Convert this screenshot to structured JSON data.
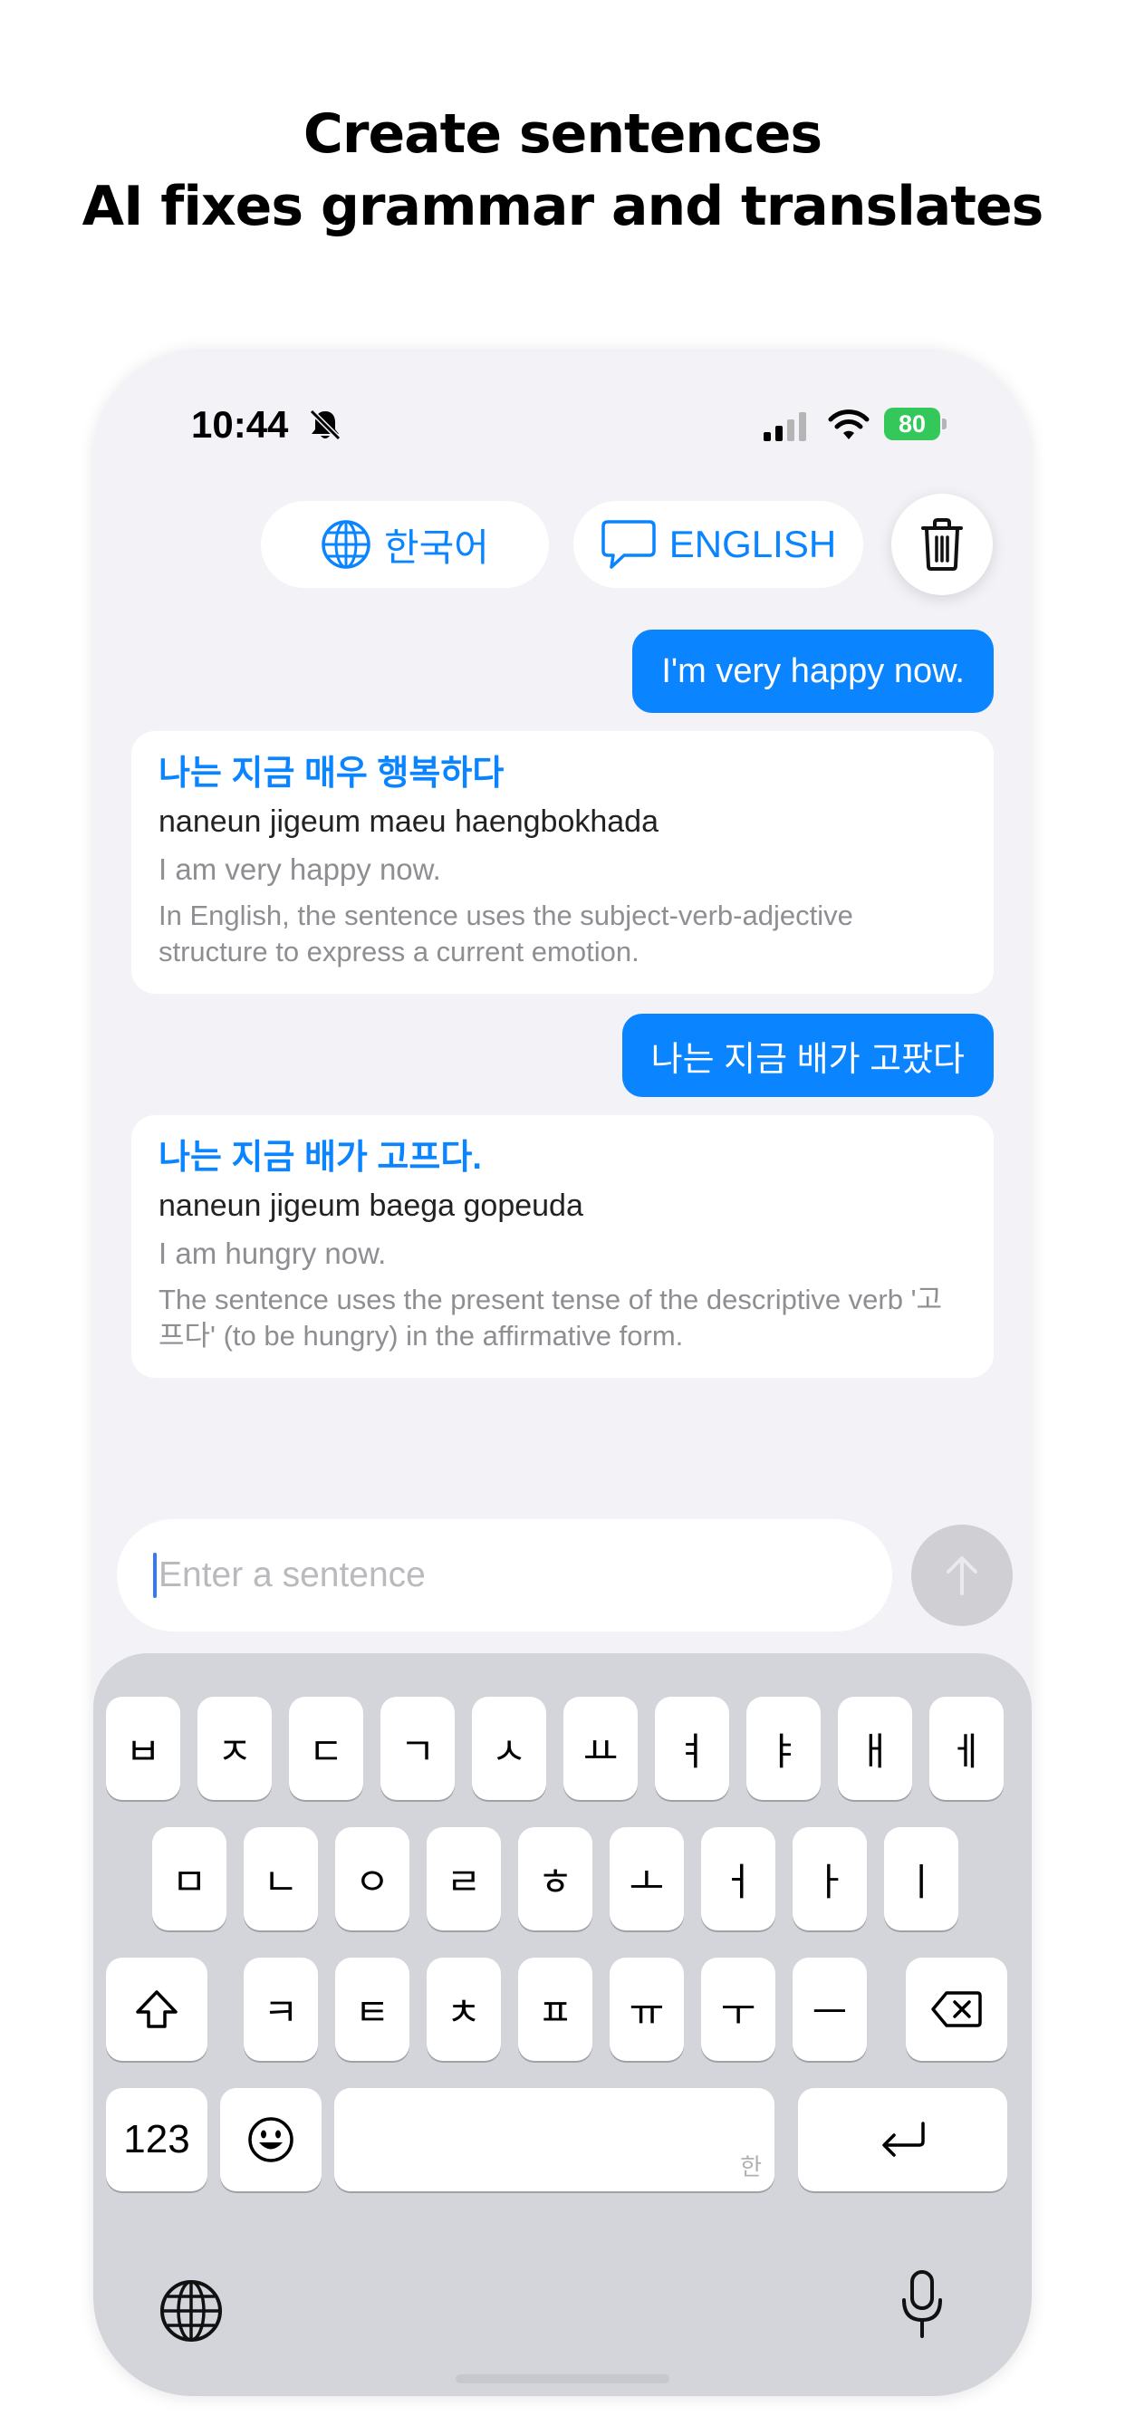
{
  "promo": {
    "line1": "Create sentences",
    "line2": "AI fixes grammar and translates"
  },
  "status_bar": {
    "time": "10:44",
    "battery": "80"
  },
  "toolbar": {
    "source_language": "한국어",
    "target_language": "ENGLISH",
    "globe_icon": "globe-icon",
    "chat_icon": "chat-bubble-icon",
    "trash_icon": "trash-icon"
  },
  "conversation": [
    {
      "user_message": "I'm very happy now.",
      "result": {
        "korean": "나는 지금 매우 행복하다",
        "romanization": "naneun jigeum maeu haengbokhada",
        "translation": "I am very happy now.",
        "explanation": "In English, the sentence uses the subject-verb-adjective structure to express a current emotion."
      }
    },
    {
      "user_message": "나는 지금 배가 고팠다",
      "result": {
        "korean": "나는 지금 배가 고프다.",
        "romanization": "naneun jigeum baega gopeuda",
        "translation": "I am hungry now.",
        "explanation": "The sentence uses the present tense of the descriptive verb '고프다' (to be hungry) in the affirmative form."
      }
    }
  ],
  "composer": {
    "placeholder": "Enter a sentence",
    "send_icon": "arrow-up-icon"
  },
  "keyboard": {
    "row1": [
      "ㅂ",
      "ㅈ",
      "ㄷ",
      "ㄱ",
      "ㅅ",
      "ㅛ",
      "ㅕ",
      "ㅑ",
      "ㅐ",
      "ㅔ"
    ],
    "row2": [
      "ㅁ",
      "ㄴ",
      "ㅇ",
      "ㄹ",
      "ㅎ",
      "ㅗ",
      "ㅓ",
      "ㅏ",
      "ㅣ"
    ],
    "row3": [
      "ㅋ",
      "ㅌ",
      "ㅊ",
      "ㅍ",
      "ㅠ",
      "ㅜ",
      "ㅡ"
    ],
    "numbers_key": "123",
    "space_hint": "한",
    "icons": [
      "shift-icon",
      "backspace-icon",
      "emoji-icon",
      "return-icon",
      "globe-icon",
      "microphone-icon"
    ]
  },
  "colors": {
    "accent": "#0a84ff",
    "background": "#f2f2f7",
    "battery": "#34c759"
  }
}
